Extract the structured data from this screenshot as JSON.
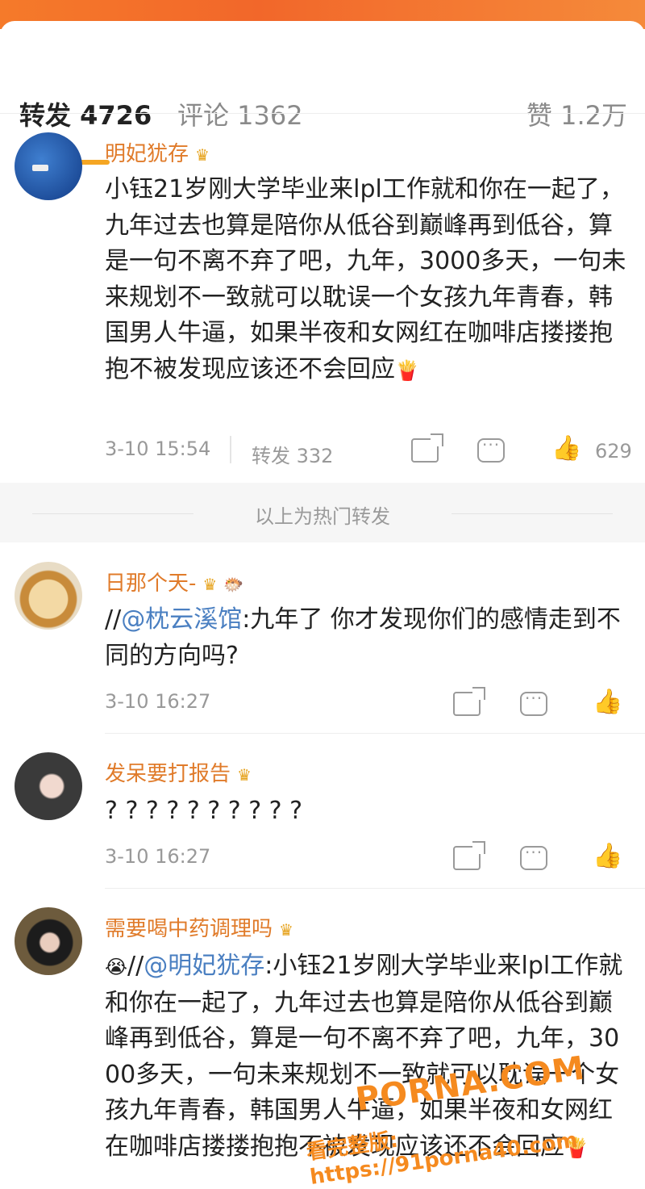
{
  "tabs": {
    "repost": "转发 4726",
    "comment": "评论 1362",
    "like": "赞 1.2万"
  },
  "colors": {
    "accent_orange": "#e07b2a",
    "link_blue": "#4a7fc1",
    "tab_underline": "#f5a623",
    "top_bar": "#f2672a"
  },
  "reposts": [
    {
      "username": "明妃犹存",
      "badge_icon": "crown-badge-icon",
      "content": "小钰21岁刚大学毕业来lpl工作就和你在一起了，九年过去也算是陪你从低谷到巅峰再到低谷，算是一句不离不弃了吧，九年，3000多天，一句未来规划不一致就可以耽误一个女孩九年青春，韩国男人牛逼，如果半夜和女网红在咖啡店搂搂抱抱不被发现应该还不会回应",
      "time": "3-10 15:54",
      "repost_count": "转发 332",
      "like_count": "629"
    }
  ],
  "hot_separator": "以上为热门转发",
  "comments": [
    {
      "username": "日那个天-",
      "prefix": "//",
      "mention": "@枕云溪馆",
      "content": ":九年了 你才发现你们的感情走到不同的方向吗?",
      "time": "3-10 16:27"
    },
    {
      "username": "发呆要打报告",
      "content": "? ? ? ? ? ? ? ? ? ?",
      "time": "3-10 16:27"
    },
    {
      "username": "需要喝中药调理吗",
      "prefix": "//",
      "mention": "@明妃犹存",
      "content": ":小钰21岁刚大学毕业来lpl工作就和你在一起了，九年过去也算是陪你从低谷到巅峰再到低谷，算是一句不离不弃了吧，九年，3000多天，一句未来规划不一致就可以耽误一个女孩九年青春，韩国男人牛逼，如果半夜和女网红在咖啡店搂搂抱抱不被发现应该还不会回应"
    }
  ],
  "watermark": {
    "brand": "PORNA.COM",
    "url_line": "看完整版: https://91porna40.com"
  }
}
